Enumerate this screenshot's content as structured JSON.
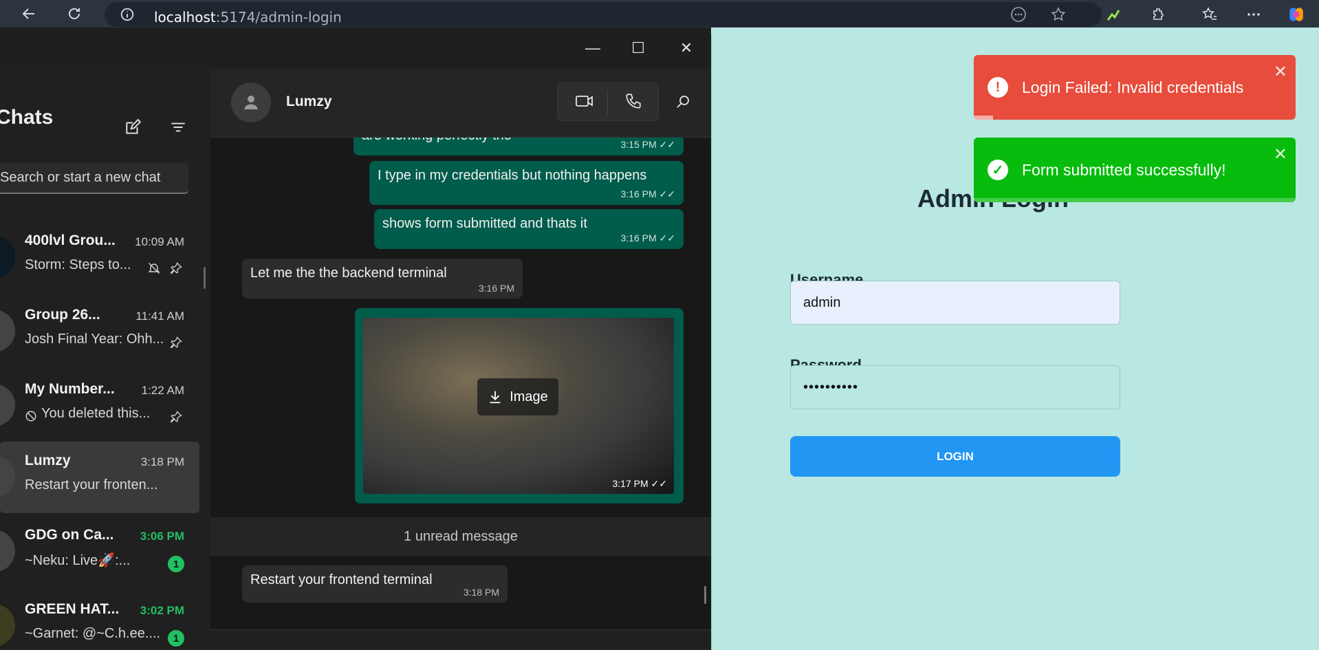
{
  "browser": {
    "url_host": "localhost",
    "url_path": ":5174/admin-login"
  },
  "login": {
    "title": "Admin Login",
    "username_label": "Username",
    "username_value": "admin",
    "password_label": "Password",
    "password_value": "••••••••••",
    "button_label": "LOGIN"
  },
  "toasts": {
    "error_text": "Login Failed: Invalid credentials",
    "success_text": "Form submitted successfully!",
    "error_progress": 0.06,
    "success_progress": 1.0
  },
  "whatsapp": {
    "sidebar_title": "Chats",
    "search_placeholder": "Search or start a new chat",
    "chats": [
      {
        "name": "400lvl Grou...",
        "time": "10:09 AM",
        "preview": "Storm: Steps to...",
        "unread": ""
      },
      {
        "name": "Group 26...",
        "time": "11:41 AM",
        "preview": "Josh Final Year: Ohh...",
        "unread": ""
      },
      {
        "name": "My Number...",
        "time": "1:22 AM",
        "preview": "You deleted this...",
        "unread": ""
      },
      {
        "name": "Lumzy",
        "time": "3:18 PM",
        "preview": "Restart your fronten...",
        "unread": ""
      },
      {
        "name": "GDG on Ca...",
        "time": "3:06 PM",
        "preview": "~Neku: Live🚀:...",
        "unread": "1"
      },
      {
        "name": "GREEN HAT...",
        "time": "3:02 PM",
        "preview": "~Garnet: @~C.h.ee....",
        "unread": "1"
      }
    ],
    "contact_name": "Lumzy",
    "messages": [
      {
        "text": "are working perfectly tho",
        "time": "3:15 PM"
      },
      {
        "text": "I type in my credentials but nothing happens",
        "time": "3:16 PM"
      },
      {
        "text": "shows form submitted and thats it",
        "time": "3:16 PM"
      },
      {
        "text": "Let me the the backend terminal",
        "time": "3:16 PM"
      },
      {
        "text": "Image",
        "time": "3:17 PM"
      },
      {
        "text": "Restart your frontend terminal",
        "time": "3:18 PM"
      }
    ],
    "unread_divider": "1 unread message"
  },
  "colors": {
    "page_bg": "#b9e7e1",
    "login_button": "#2196f3",
    "toast_error": "#e74c3c",
    "toast_success": "#07bc0c",
    "outgoing_bubble": "#005c4b"
  }
}
